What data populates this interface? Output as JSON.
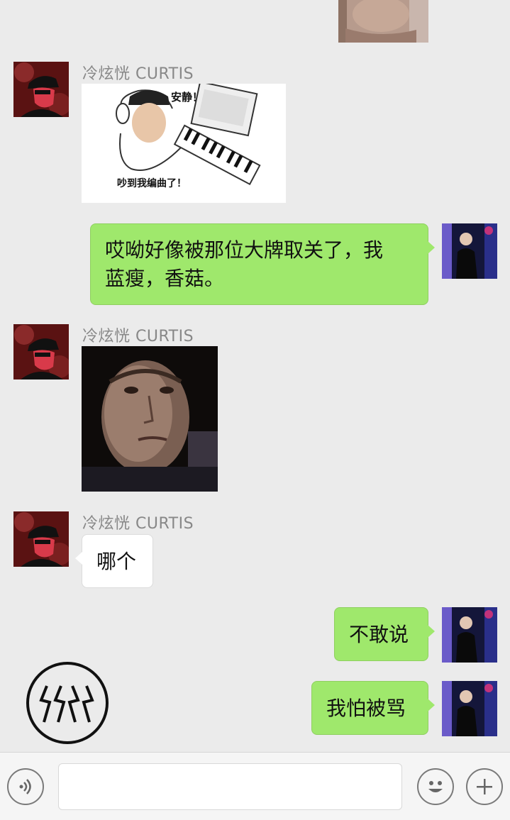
{
  "messages": [
    {
      "type": "image",
      "direction": "out",
      "content": "photo (cropped)"
    },
    {
      "type": "sticker",
      "direction": "in",
      "sender": "冷炫恍 CURTIS",
      "texts": {
        "top": "安静！",
        "bottom": "吵到我编曲了！"
      }
    },
    {
      "type": "text",
      "direction": "out",
      "lines": [
        "哎呦好像被那位大牌取关了，我",
        "蓝瘦，香菇。"
      ]
    },
    {
      "type": "image",
      "direction": "in",
      "sender": "冷炫恍 CURTIS",
      "content": "crying man photo"
    },
    {
      "type": "text",
      "direction": "in",
      "sender": "冷炫恍 CURTIS",
      "text": "哪个"
    },
    {
      "type": "text",
      "direction": "out",
      "text": "不敢说"
    },
    {
      "type": "text",
      "direction": "out",
      "text": "我怕被骂"
    }
  ],
  "input_bar": {
    "voice_icon": "voice-icon",
    "emoji_icon": "emoji-icon",
    "plus_icon": "plus-icon",
    "text_value": ""
  },
  "colors": {
    "background": "#ebebeb",
    "outgoing_bubble": "#9fe86c",
    "incoming_bubble": "#ffffff",
    "sender_name": "#888888"
  }
}
